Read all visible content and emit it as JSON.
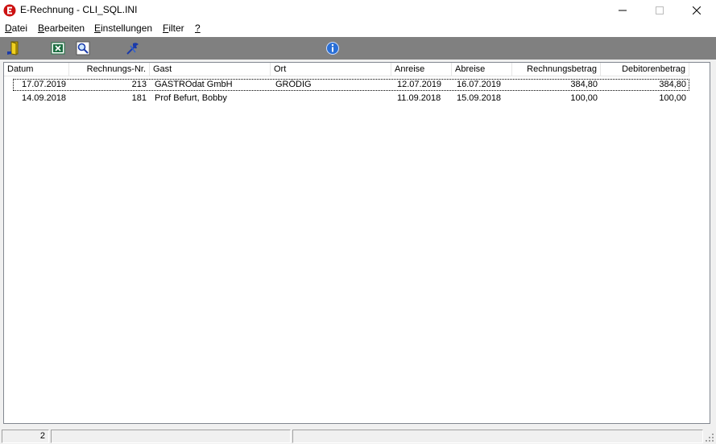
{
  "window": {
    "title": "E-Rechnung - CLI_SQL.INI"
  },
  "menu": [
    {
      "accel": "D",
      "rest": "atei"
    },
    {
      "accel": "B",
      "rest": "earbeiten"
    },
    {
      "accel": "E",
      "rest": "instellungen"
    },
    {
      "accel": "F",
      "rest": "ilter"
    },
    {
      "accel": "?",
      "rest": ""
    }
  ],
  "toolbar": {
    "buttons": [
      "exit-door-icon",
      "excel-icon",
      "search-icon",
      "tools-icon",
      "info-icon"
    ]
  },
  "table": {
    "columns": [
      "Datum",
      "Rechnungs-Nr.",
      "Gast",
      "Ort",
      "Anreise",
      "Abreise",
      "Rechnungsbetrag",
      "Debitorenbetrag"
    ],
    "rows": [
      [
        "17.07.2019",
        "213",
        "GASTROdat GmbH",
        "GRÖDIG",
        "12.07.2019",
        "16.07.2019",
        "384,80",
        "384,80"
      ],
      [
        "14.09.2018",
        "181",
        "Prof Befurt, Bobby",
        "",
        "11.09.2018",
        "15.09.2018",
        "100,00",
        "100,00"
      ]
    ]
  },
  "status": {
    "count": "2"
  },
  "colors": {
    "toolbar_bg": "#808080",
    "app_icon_red": "#cc1111"
  }
}
